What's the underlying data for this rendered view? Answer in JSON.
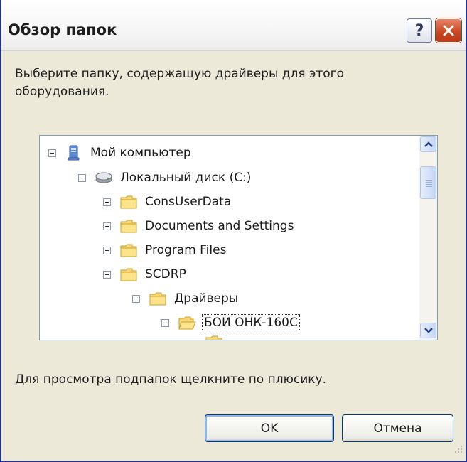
{
  "window": {
    "title": "Обзор папок",
    "help_label": "?",
    "accent": "#0831d9",
    "close_color": "#c94520"
  },
  "instruction": "Выберите папку, содержащую драйверы для этого оборудования.",
  "tree": {
    "nodes": [
      {
        "label": "Мой компьютер",
        "icon": "computer-icon",
        "expander": "minus",
        "level": 0
      },
      {
        "label": "Локальный диск (C:)",
        "icon": "drive-icon",
        "expander": "minus",
        "level": 1
      },
      {
        "label": "ConsUserData",
        "icon": "folder-icon",
        "expander": "plus",
        "level": 2
      },
      {
        "label": "Documents and Settings",
        "icon": "folder-icon",
        "expander": "plus",
        "level": 2
      },
      {
        "label": "Program Files",
        "icon": "folder-icon",
        "expander": "plus",
        "level": 2
      },
      {
        "label": "SCDRP",
        "icon": "folder-icon",
        "expander": "minus",
        "level": 2
      },
      {
        "label": "Драйверы",
        "icon": "folder-icon",
        "expander": "minus",
        "level": 3
      },
      {
        "label": "БОИ ОНК-160С",
        "icon": "open-folder-icon",
        "expander": "minus",
        "level": 4,
        "selected": true
      }
    ]
  },
  "hint": "Для просмотра подпапок щелкните по плюсику.",
  "buttons": {
    "ok": "OK",
    "cancel": "Отмена"
  }
}
